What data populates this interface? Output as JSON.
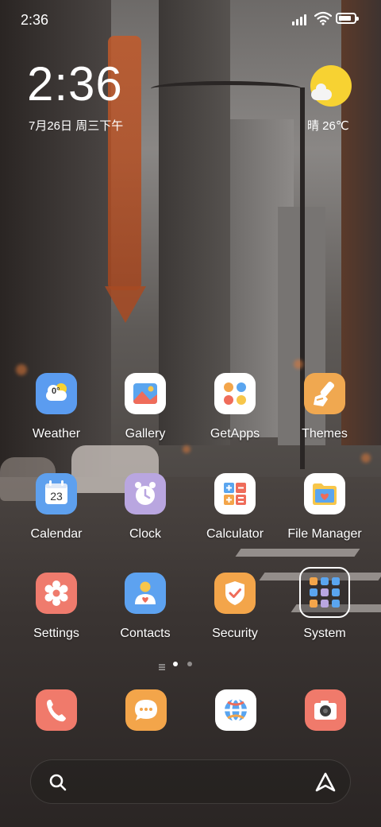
{
  "status_bar": {
    "time": "2:36",
    "icons": [
      "signal-icon",
      "wifi-icon",
      "battery-icon"
    ],
    "battery_level": 0.85
  },
  "clock_widget": {
    "time": "2:36",
    "date": "7月26日 周三下午"
  },
  "weather_widget": {
    "icon": "sun-cloud-icon",
    "text": "晴 26℃"
  },
  "apps": [
    {
      "label": "Weather",
      "icon": "weather-icon",
      "color": "#5b9cf0",
      "badge": "0°"
    },
    {
      "label": "Gallery",
      "icon": "gallery-icon",
      "color": "#ffffff"
    },
    {
      "label": "GetApps",
      "icon": "getapps-icon",
      "color": "#ffffff"
    },
    {
      "label": "Themes",
      "icon": "themes-brush-icon",
      "color": "#f0a850"
    },
    {
      "label": "Calendar",
      "icon": "calendar-icon",
      "color": "#5ea0ee",
      "badge": "23"
    },
    {
      "label": "Clock",
      "icon": "alarm-clock-icon",
      "color": "#b9a6e0"
    },
    {
      "label": "Calculator",
      "icon": "calculator-icon",
      "color": "#ffffff"
    },
    {
      "label": "File Manager",
      "icon": "folder-icon",
      "color": "#ffffff"
    },
    {
      "label": "Settings",
      "icon": "gear-icon",
      "color": "#ef7b6d"
    },
    {
      "label": "Contacts",
      "icon": "contact-person-icon",
      "color": "#5da2f0"
    },
    {
      "label": "Security",
      "icon": "shield-icon",
      "color": "#f3a54a"
    },
    {
      "label": "System",
      "icon": "folder-grid-icon",
      "color": "#ffffff"
    }
  ],
  "pager": {
    "pages": 2,
    "current": 1
  },
  "dock": [
    {
      "name": "phone",
      "icon": "phone-icon",
      "color": "#f07a6b"
    },
    {
      "name": "messaging",
      "icon": "message-bubble-icon",
      "color": "#f3a54a"
    },
    {
      "name": "browser",
      "icon": "browser-globe-icon",
      "color": "#ffffff"
    },
    {
      "name": "camera",
      "icon": "camera-icon",
      "color": "#f07a6b"
    }
  ],
  "search_bar": {
    "left_icon": "search-icon",
    "right_icon": "assistant-icon"
  }
}
